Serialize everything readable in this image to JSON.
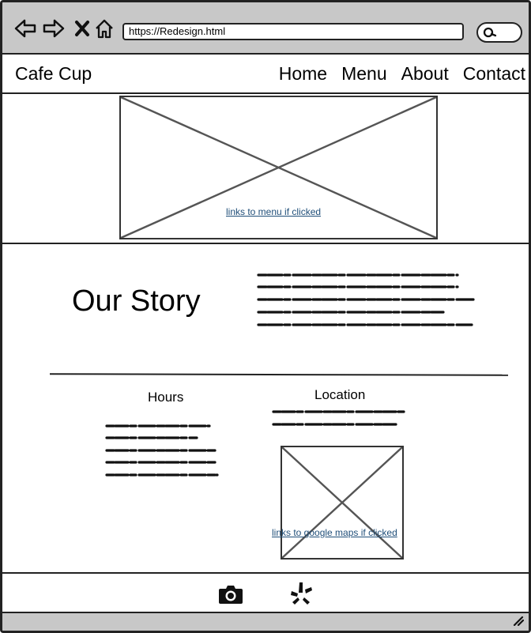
{
  "browser": {
    "url": "https://Redesign.html",
    "icons": [
      "back-arrow-icon",
      "forward-arrow-icon",
      "close-icon",
      "home-icon",
      "search-icon"
    ]
  },
  "header": {
    "brand": "Cafe Cup",
    "nav": [
      "Home",
      "Menu",
      "About",
      "Contact"
    ]
  },
  "hero": {
    "image_link": "links to menu if clicked"
  },
  "story": {
    "title": "Our Story"
  },
  "hours": {
    "title": "Hours"
  },
  "location": {
    "title": "Location",
    "map_link": "links to google maps if clicked"
  },
  "footer": {
    "icons": [
      "camera-icon",
      "yelp-icon"
    ]
  },
  "colors": {
    "chrome": "#c8c8c8",
    "link": "#1f4e79",
    "line": "#222222"
  }
}
